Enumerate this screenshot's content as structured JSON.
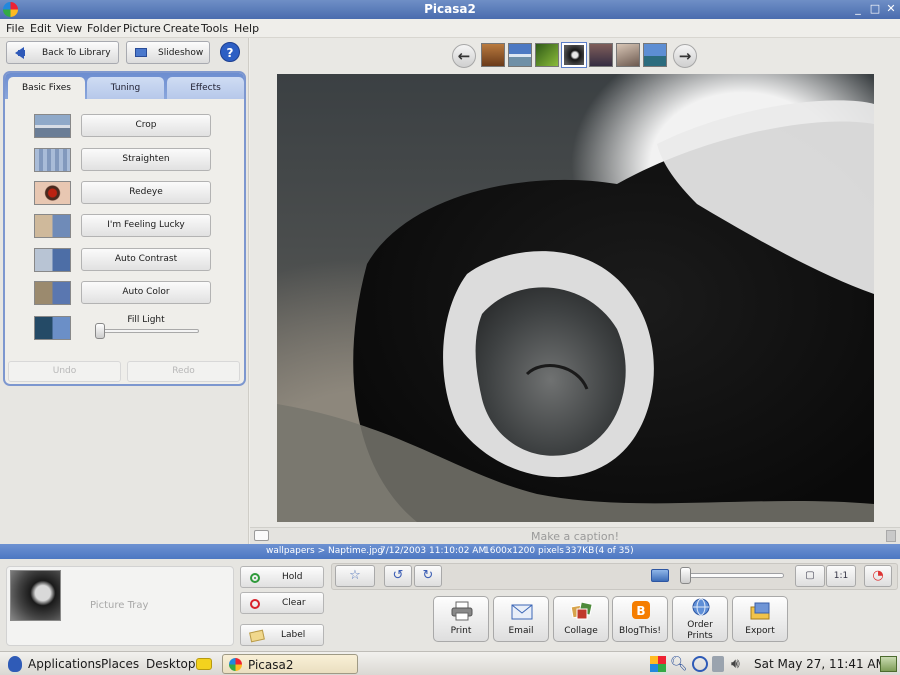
{
  "window": {
    "title": "Picasa2",
    "controls": [
      "_",
      "□",
      "✕"
    ]
  },
  "menubar": {
    "items": [
      "File",
      "Edit",
      "View",
      "Folder",
      "Picture",
      "Create",
      "Tools",
      "Help"
    ]
  },
  "left_panel": {
    "back_button": "Back To Library",
    "slideshow_button": "Slideshow",
    "help_button": "?",
    "tabs": [
      "Basic Fixes",
      "Tuning",
      "Effects"
    ],
    "active_tab": "Basic Fixes",
    "fixes": [
      "Crop",
      "Straighten",
      "Redeye",
      "I'm Feeling Lucky",
      "Auto Contrast",
      "Auto Color"
    ],
    "fill_light_label": "Fill Light",
    "fill_light_value": 0,
    "undo": "Undo",
    "redo": "Redo"
  },
  "viewer": {
    "prev_arrow": "←",
    "next_arrow": "→",
    "filmstrip_count": 7,
    "selected_index": 3,
    "caption_placeholder": "Make a caption!"
  },
  "status": {
    "path": "wallpapers > Naptime.jpg",
    "datetime": "7/12/2003 11:10:02 AM",
    "dimensions": "1600x1200 pixels",
    "size": "337KB",
    "position": "(4 of 35)"
  },
  "tray": {
    "label": "Picture Tray",
    "hold": "Hold",
    "clear": "Clear",
    "label_button": "Label"
  },
  "toolbar": {
    "star": "☆",
    "rotate_left": "↺",
    "rotate_right": "↻",
    "zoom_level": 0,
    "fit_label": "1:1"
  },
  "actions": [
    {
      "label": "Print",
      "icon": "printer-icon"
    },
    {
      "label": "Email",
      "icon": "email-icon"
    },
    {
      "label": "Collage",
      "icon": "collage-icon"
    },
    {
      "label": "BlogThis!",
      "icon": "blogger-icon"
    },
    {
      "label": "Order Prints",
      "icon": "order-prints-icon"
    },
    {
      "label": "Export",
      "icon": "export-icon"
    }
  ],
  "gnome_panel": {
    "applications": "Applications",
    "places": "Places",
    "desktop": "Desktop",
    "task": "Picasa2",
    "clock": "Sat May 27, 11:41 AM"
  },
  "colors": {
    "accent": "#4a6cae",
    "status_bar": "#5b82c8"
  }
}
